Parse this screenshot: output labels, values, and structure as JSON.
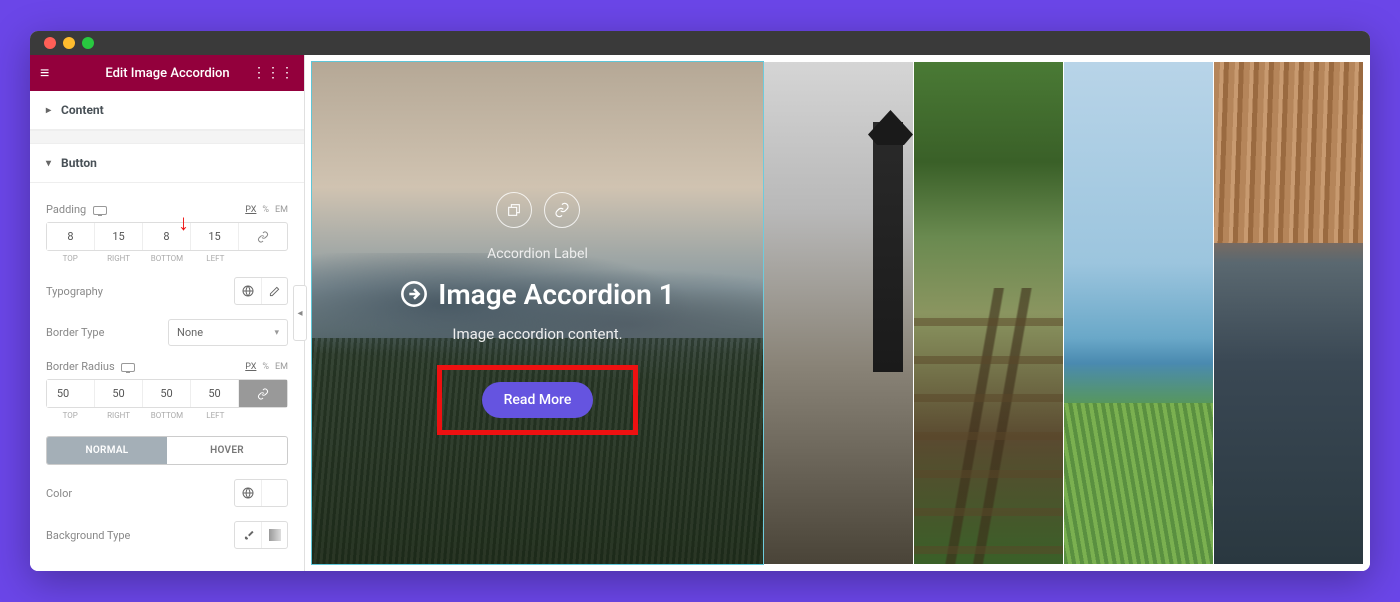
{
  "panel": {
    "title": "Edit Image Accordion",
    "sections": {
      "content": "Content",
      "button": "Button"
    }
  },
  "button_section": {
    "padding": {
      "label": "Padding",
      "units": {
        "px": "PX",
        "pct": "%",
        "em": "EM"
      },
      "top": "8",
      "right": "15",
      "bottom": "8",
      "left": "15",
      "sub": {
        "top": "TOP",
        "right": "RIGHT",
        "bottom": "BOTTOM",
        "left": "LEFT"
      }
    },
    "typography": {
      "label": "Typography"
    },
    "border_type": {
      "label": "Border Type",
      "value": "None"
    },
    "border_radius": {
      "label": "Border Radius",
      "units": {
        "px": "PX",
        "pct": "%",
        "em": "EM"
      },
      "top": "50",
      "right": "50",
      "bottom": "50",
      "left": "50",
      "sub": {
        "top": "TOP",
        "right": "RIGHT",
        "bottom": "BOTTOM",
        "left": "LEFT"
      }
    },
    "tabs": {
      "normal": "NORMAL",
      "hover": "HOVER"
    },
    "color": {
      "label": "Color"
    },
    "bg_type": {
      "label": "Background Type"
    }
  },
  "preview": {
    "label": "Accordion Label",
    "title": "Image Accordion 1",
    "text": "Image accordion content.",
    "button": "Read More"
  }
}
